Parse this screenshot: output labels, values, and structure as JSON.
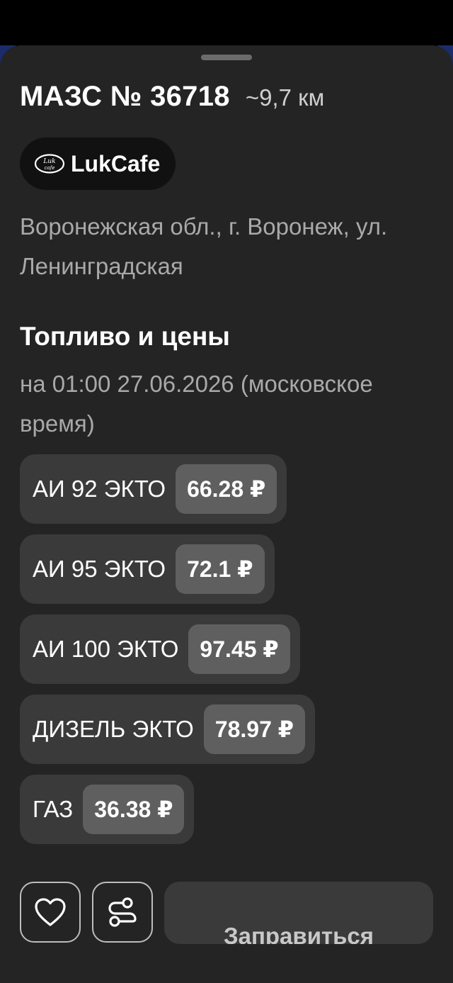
{
  "station": {
    "name": "МАЗС № 36718",
    "distance": "~9,7 км"
  },
  "badge": {
    "logo_text": "Luk cafe",
    "label": "LukCafe"
  },
  "address": "Воронежская обл., г. Воронеж, ул. Ленинградская",
  "fuel_section": {
    "title": "Топливо и цены",
    "date_line": "на 01:00 27.06.2026 (московское время)"
  },
  "fuels": [
    {
      "name": "АИ 92 ЭКТО",
      "price": "66.28 ₽"
    },
    {
      "name": "АИ 95 ЭКТО",
      "price": "72.1 ₽"
    },
    {
      "name": "АИ 100 ЭКТО",
      "price": "97.45 ₽"
    },
    {
      "name": "ДИЗЕЛЬ ЭКТО",
      "price": "78.97 ₽"
    },
    {
      "name": "ГАЗ",
      "price": "36.38 ₽"
    }
  ],
  "actions": {
    "favorite_icon": "heart-icon",
    "route_icon": "route-icon",
    "primary_label": "Заправиться"
  },
  "colors": {
    "sheet_bg": "#242424",
    "chip_bg": "#3a3a3a",
    "price_bg": "#5f5f5f",
    "badge_bg": "#111111"
  }
}
